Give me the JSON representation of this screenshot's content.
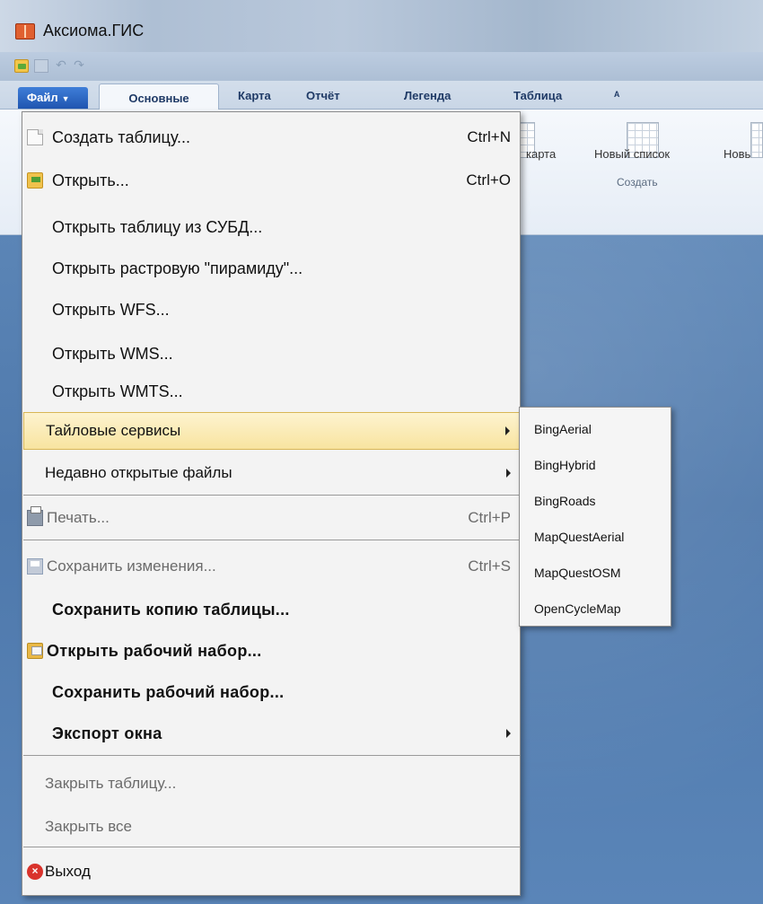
{
  "window": {
    "title": "Аксиома.ГИС"
  },
  "ribbon": {
    "tabs": {
      "file": "Файл",
      "main": "Основные",
      "map": "Карта",
      "report": "Отчёт",
      "legend": "Легенда",
      "table": "Таблица",
      "extra": "ᴬ"
    },
    "buttons": {
      "map_partial": "карта",
      "new_list": "Новый список",
      "new_partial": "Новь"
    },
    "group_create": "Создать"
  },
  "menu": {
    "create_table": {
      "label": "Создать таблицу...",
      "shortcut": "Ctrl+N"
    },
    "open": {
      "label": "Открыть...",
      "shortcut": "Ctrl+O"
    },
    "open_dbms": {
      "label": "Открыть таблицу из СУБД..."
    },
    "open_pyramid": {
      "label": "Открыть растровую \"пирамиду\"..."
    },
    "open_wfs": {
      "label": "Открыть WFS..."
    },
    "open_wms": {
      "label": "Открыть WMS..."
    },
    "open_wmts": {
      "label": "Открыть WMTS..."
    },
    "tile_services": {
      "label": "Тайловые сервисы"
    },
    "recent_files": {
      "label": "Недавно открытые файлы"
    },
    "print": {
      "label": "Печать...",
      "shortcut": "Ctrl+P"
    },
    "save_changes": {
      "label": "Сохранить изменения...",
      "shortcut": "Ctrl+S"
    },
    "save_copy": {
      "label": "Сохранить копию таблицы..."
    },
    "open_workset": {
      "label": "Открыть рабочий набор..."
    },
    "save_workset": {
      "label": "Сохранить рабочий набор..."
    },
    "export_window": {
      "label": "Экспорт окна"
    },
    "close_table": {
      "label": "Закрыть таблицу..."
    },
    "close_all": {
      "label": "Закрыть все"
    },
    "exit": {
      "label": "Выход"
    }
  },
  "submenu": {
    "items": [
      "BingAerial",
      "BingHybrid",
      "BingRoads",
      "MapQuestAerial",
      "MapQuestOSM",
      "OpenCycleMap"
    ]
  },
  "icons": {
    "app": "map-book-icon",
    "new_table": "document-icon",
    "open": "open-folder-icon",
    "print": "printer-icon",
    "save": "save-table-icon",
    "workset": "workset-folder-icon",
    "exit": "exit-icon"
  },
  "colors": {
    "highlight": "#f8e4a0",
    "file_tab": "#2a62c0",
    "workspace": "#5b85b6"
  }
}
